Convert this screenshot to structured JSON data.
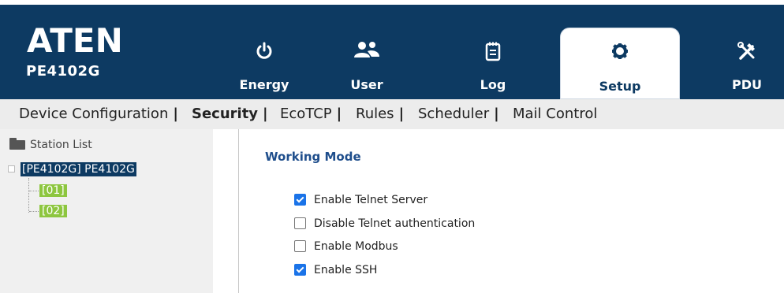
{
  "app": {
    "brand": "ATEN",
    "model": "PE4102G"
  },
  "tabs": [
    {
      "label": "Energy",
      "icon": "power-icon"
    },
    {
      "label": "User",
      "icon": "users-icon"
    },
    {
      "label": "Log",
      "icon": "clipboard-icon"
    },
    {
      "label": "Setup",
      "icon": "gear-icon",
      "active": true
    },
    {
      "label": "PDU",
      "icon": "tools-icon"
    }
  ],
  "subnav": {
    "items": [
      "Device Configuration",
      "Security",
      "EcoTCP",
      "Rules",
      "Scheduler",
      "Mail Control"
    ],
    "separator": "|",
    "active": "Security"
  },
  "sidebar": {
    "header": "Station List",
    "root": "[PE4102G] PE4102G",
    "ports": [
      "[01]",
      "[02]"
    ]
  },
  "main": {
    "section_title": "Working Mode",
    "options": [
      {
        "label": "Enable Telnet Server",
        "checked": true
      },
      {
        "label": "Disable Telnet authentication",
        "checked": false
      },
      {
        "label": "Enable Modbus",
        "checked": false
      },
      {
        "label": "Enable SSH",
        "checked": true
      }
    ]
  },
  "colors": {
    "header_bg": "#0d3a62",
    "port_green": "#8dc63f",
    "checkbox_blue": "#1a73e8",
    "title_blue": "#1f4e8c"
  }
}
